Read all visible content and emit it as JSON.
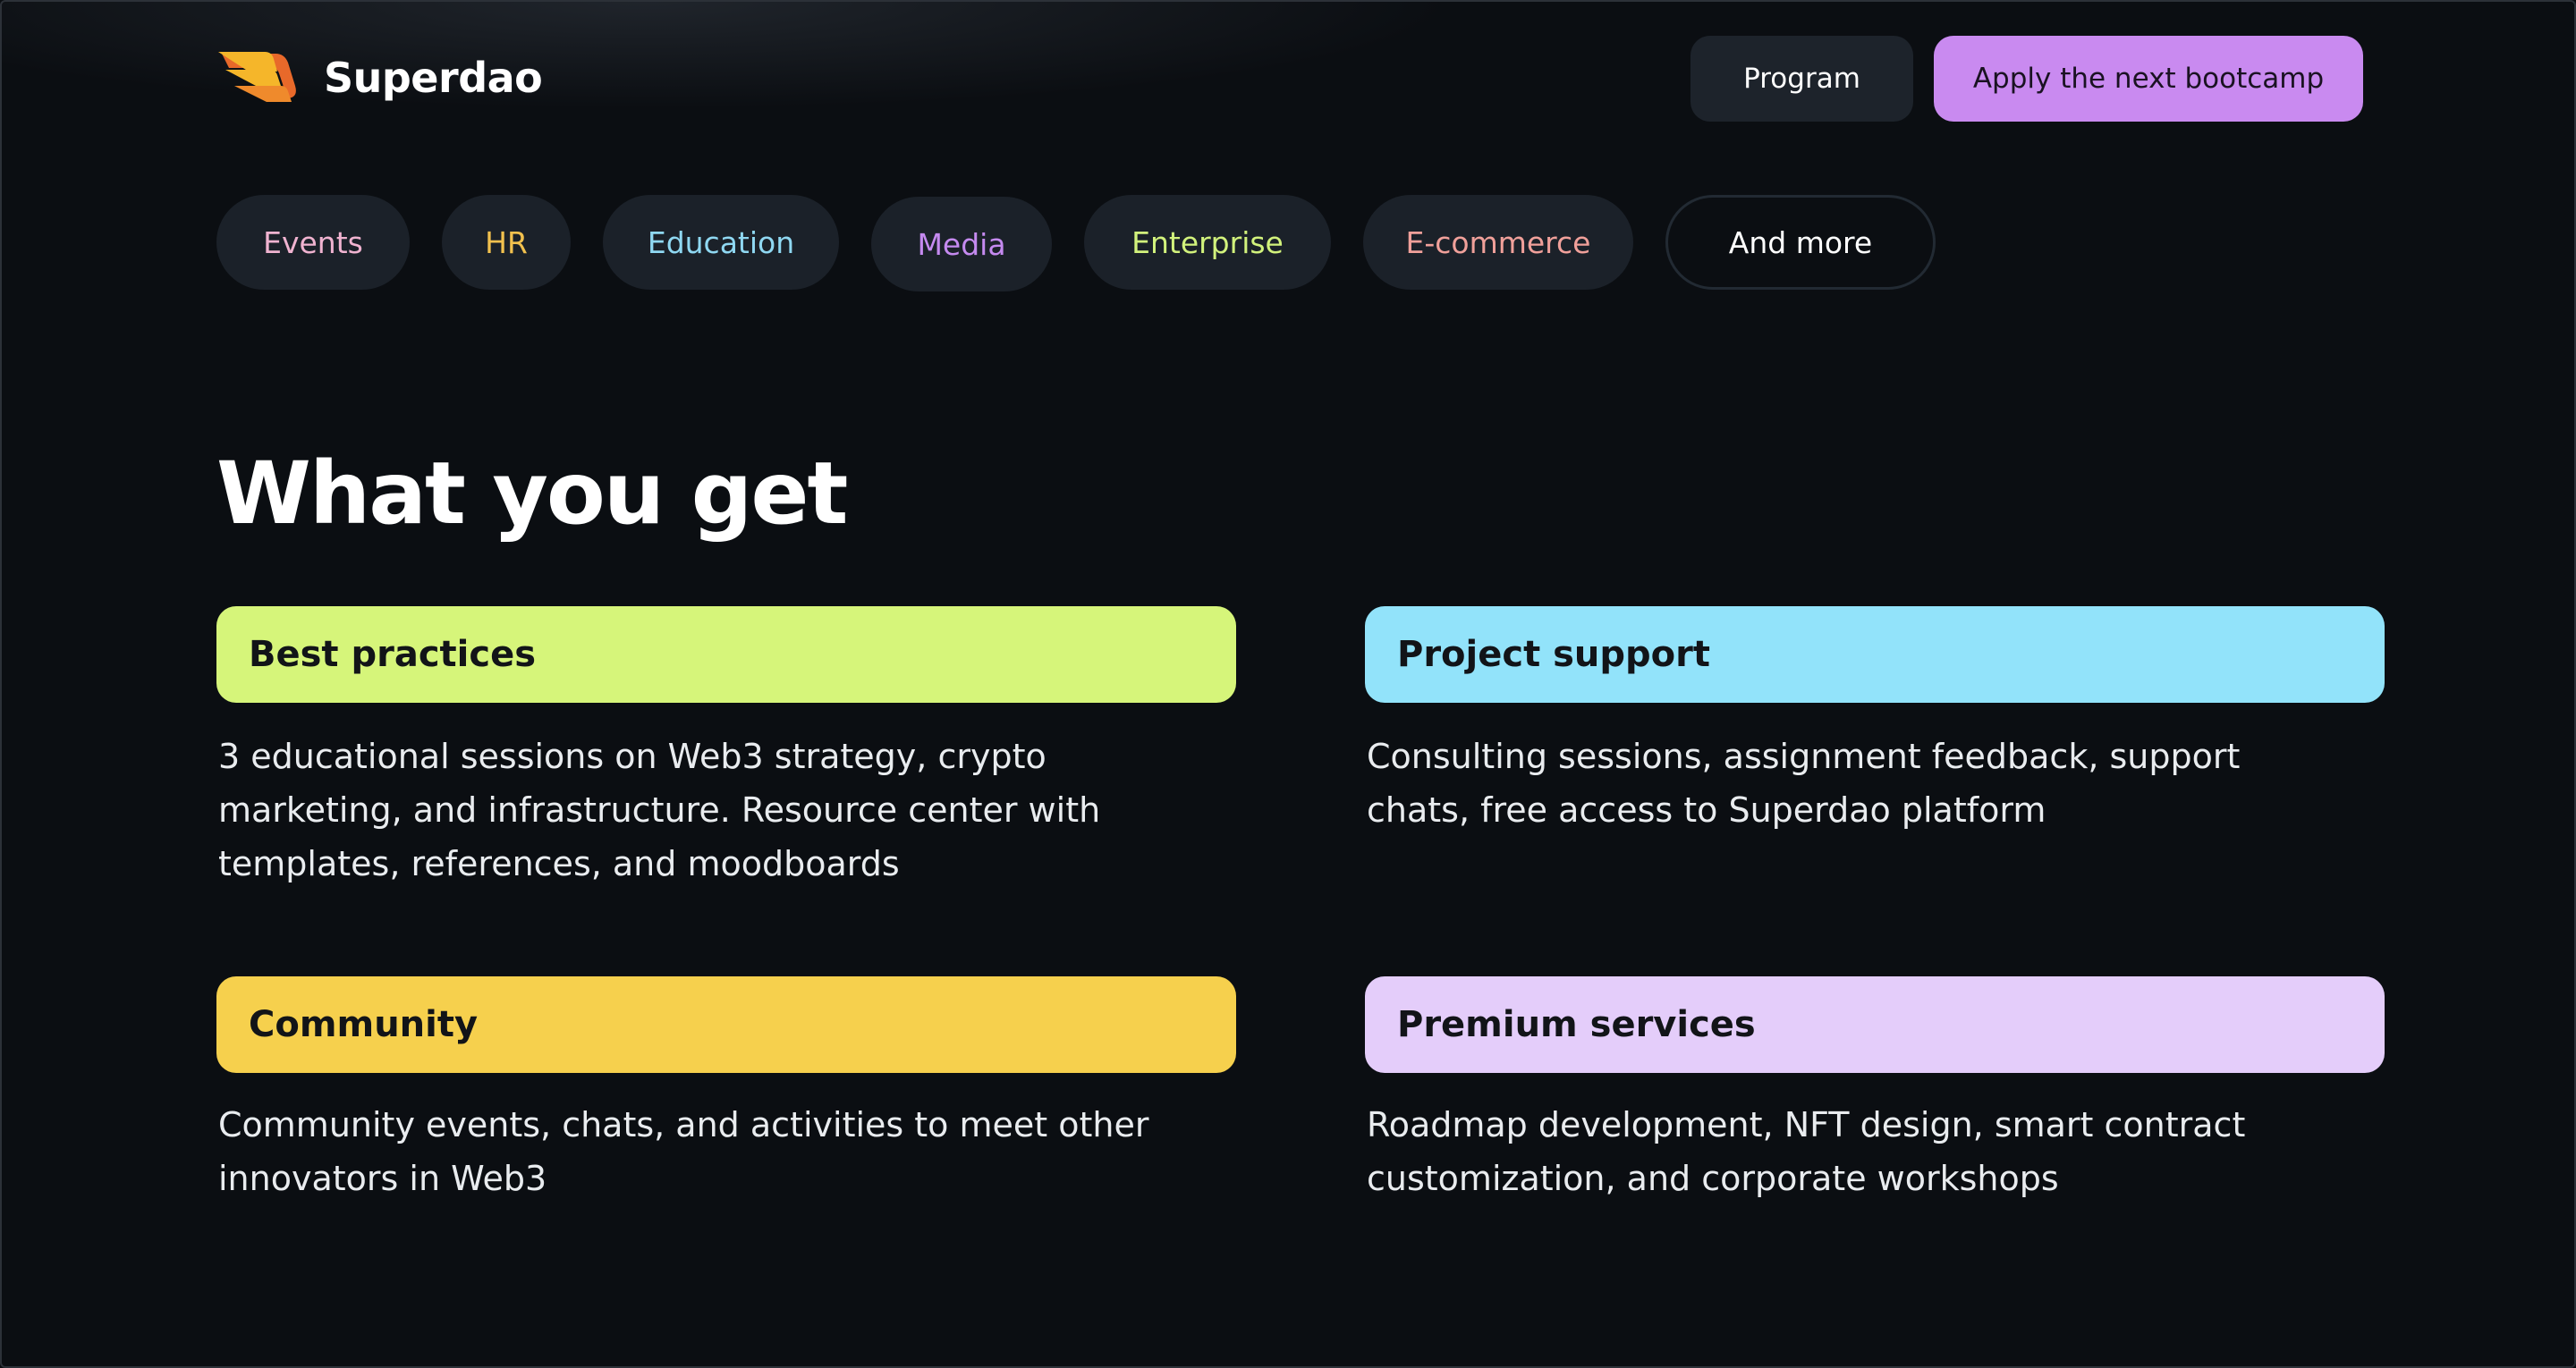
{
  "header": {
    "logo_text": "Superdao",
    "program_label": "Program",
    "apply_label": "Apply the next bootcamp"
  },
  "tags": [
    {
      "label": "Events",
      "color": "#f0b3d0"
    },
    {
      "label": "HR",
      "color": "#f2c14e"
    },
    {
      "label": "Education",
      "color": "#8fd8f2"
    },
    {
      "label": "Media",
      "color": "#c58af0"
    },
    {
      "label": "Enterprise",
      "color": "#d2f27c"
    },
    {
      "label": "E-commerce",
      "color": "#f0a09a"
    },
    {
      "label": "And more",
      "color": "#ffffff"
    }
  ],
  "section": {
    "title": "What you get"
  },
  "features": [
    {
      "title": "Best practices",
      "color": "#d6f57a",
      "description": "3 educational sessions on Web3 strategy, crypto marketing, and infrastructure. Resource center with templates, references, and moodboards"
    },
    {
      "title": "Project support",
      "color": "#92e3fa",
      "description": "Consulting sessions, assignment feedback, support chats, free access to Superdao platform"
    },
    {
      "title": "Community",
      "color": "#f6d04d",
      "description": "Community events, chats, and activities to meet other innovators in Web3"
    },
    {
      "title": "Premium services",
      "color": "#e4cdfa",
      "description": "Roadmap development, NFT design, smart contract customization, and corporate workshops"
    }
  ],
  "colors": {
    "background": "#0b0e12",
    "pill_background": "#1b2129",
    "accent_purple": "#c98af0"
  }
}
